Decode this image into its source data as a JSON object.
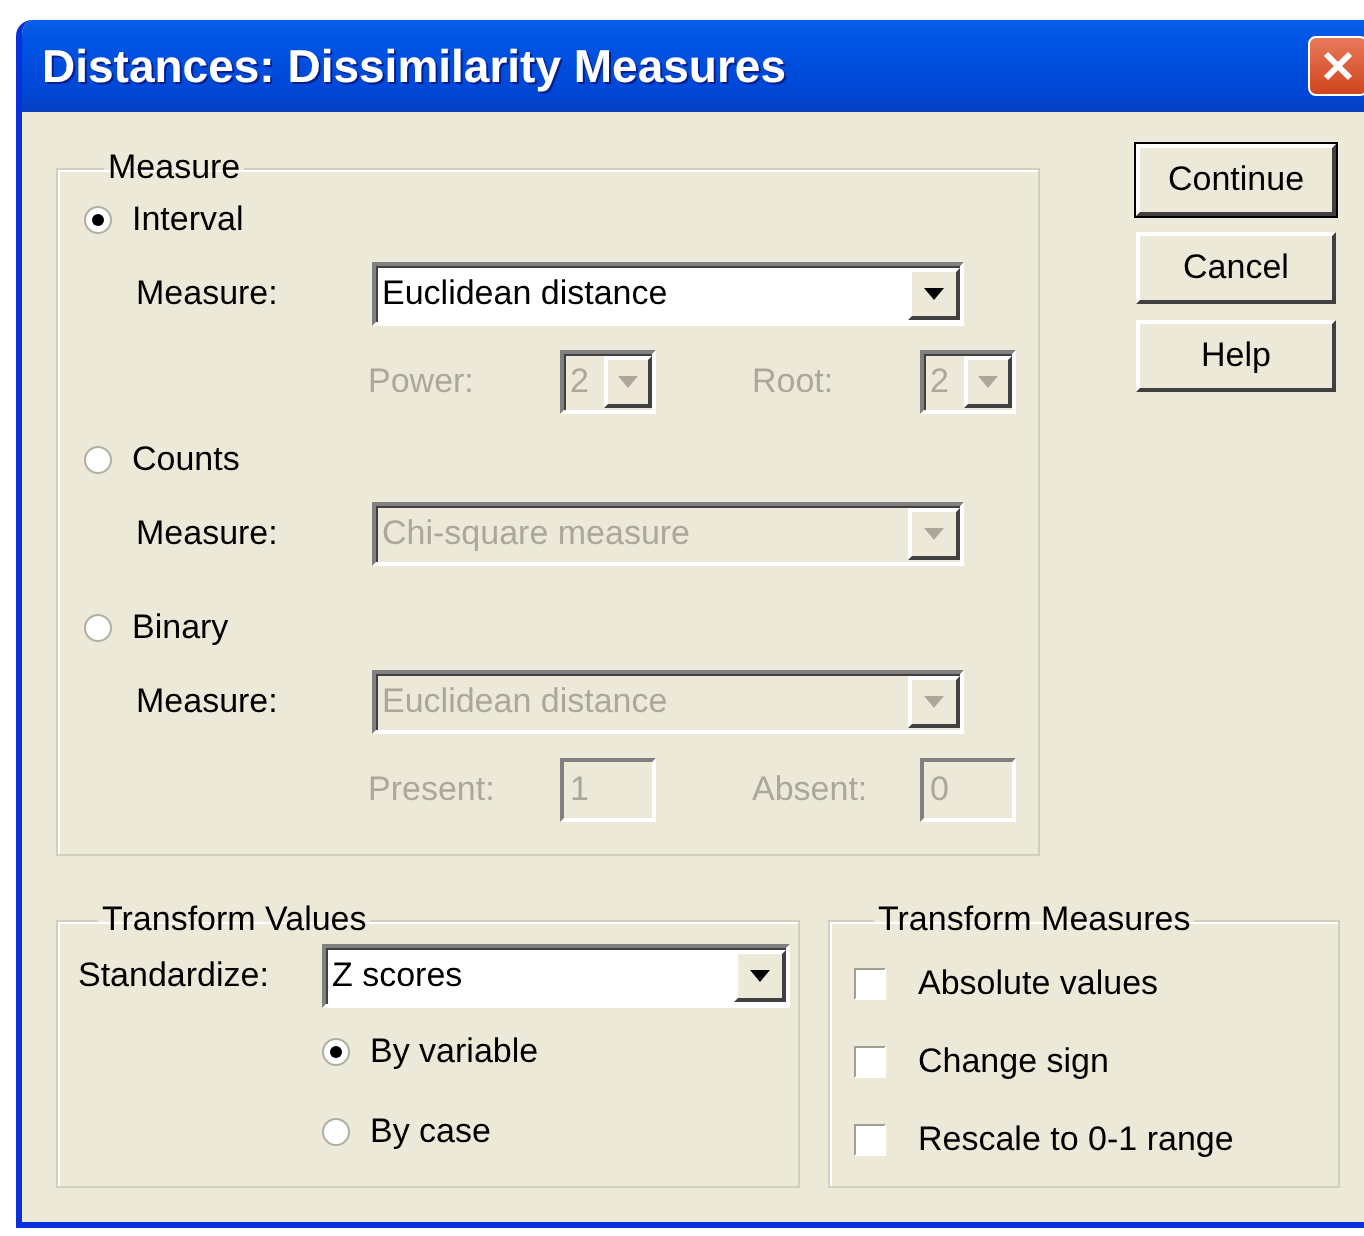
{
  "window": {
    "title": "Distances: Dissimilarity Measures"
  },
  "measure_group": {
    "title": "Measure",
    "options": [
      {
        "label": "Interval",
        "selected": true,
        "measure_label": "Measure:",
        "measure_value": "Euclidean distance",
        "disabled": false,
        "params": [
          {
            "kind": "combo",
            "label": "Power:",
            "value": "2",
            "disabled": true
          },
          {
            "kind": "combo",
            "label": "Root:",
            "value": "2",
            "disabled": true
          }
        ]
      },
      {
        "label": "Counts",
        "selected": false,
        "measure_label": "Measure:",
        "measure_value": "Chi-square measure",
        "disabled": true
      },
      {
        "label": "Binary",
        "selected": false,
        "measure_label": "Measure:",
        "measure_value": "Euclidean distance",
        "disabled": true,
        "params": [
          {
            "kind": "field",
            "label": "Present:",
            "value": "1",
            "disabled": true
          },
          {
            "kind": "field",
            "label": "Absent:",
            "value": "0",
            "disabled": true
          }
        ]
      }
    ]
  },
  "buttons": [
    {
      "label": "Continue",
      "default": true
    },
    {
      "label": "Cancel",
      "default": false
    },
    {
      "label": "Help",
      "default": false
    }
  ],
  "transform_values": {
    "title": "Transform Values",
    "label": "Standardize:",
    "value": "Z scores",
    "options": [
      {
        "label": "By variable",
        "selected": true
      },
      {
        "label": "By case",
        "selected": false
      }
    ]
  },
  "transform_measures": {
    "title": "Transform Measures",
    "options": [
      {
        "label": "Absolute values",
        "checked": false
      },
      {
        "label": "Change sign",
        "checked": false
      },
      {
        "label": "Rescale to 0-1 range",
        "checked": false
      }
    ]
  }
}
